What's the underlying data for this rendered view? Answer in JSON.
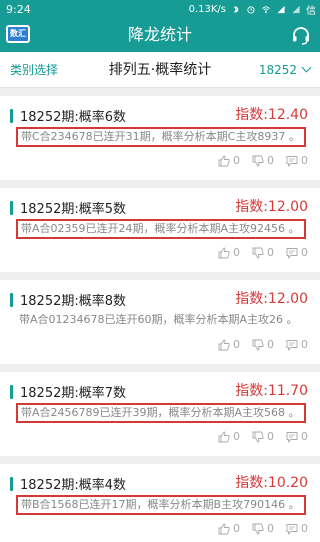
{
  "status_bar": {
    "time": "9:24",
    "net_speed": "0.13K/s",
    "carrier": "信"
  },
  "nav": {
    "logo_text": "数汇",
    "title": "降龙统计"
  },
  "filter": {
    "category_label": "类别选择",
    "title": "排列五·概率统计",
    "issue": "18252"
  },
  "cards": [
    {
      "title": "18252期:概率6数",
      "index": "指数:12.40",
      "desc": "带C合234678已连开31期，概率分析本期C主攻8937 。",
      "boxed": true,
      "likes": "0",
      "dislikes": "0",
      "comments": "0"
    },
    {
      "title": "18252期:概率5数",
      "index": "指数:12.00",
      "desc": "带A合02359已连开24期，概率分析本期A主攻92456 。",
      "boxed": true,
      "likes": "0",
      "dislikes": "0",
      "comments": "0"
    },
    {
      "title": "18252期:概率8数",
      "index": "指数:12.00",
      "desc": "带A合01234678已连开60期，概率分析本期A主攻26 。",
      "boxed": false,
      "likes": "0",
      "dislikes": "0",
      "comments": "0"
    },
    {
      "title": "18252期:概率7数",
      "index": "指数:11.70",
      "desc": "带A合2456789已连开39期，概率分析本期A主攻568 。",
      "boxed": true,
      "likes": "0",
      "dislikes": "0",
      "comments": "0"
    },
    {
      "title": "18252期:概率4数",
      "index": "指数:10.20",
      "desc": "带B合1568已连开17期，概率分析本期B主攻790146 。",
      "boxed": true,
      "likes": "0",
      "dislikes": "0",
      "comments": "0"
    }
  ],
  "colors": {
    "accent": "#169b95",
    "index_red": "#d33a3a",
    "highlight_box": "#d23a3a"
  }
}
